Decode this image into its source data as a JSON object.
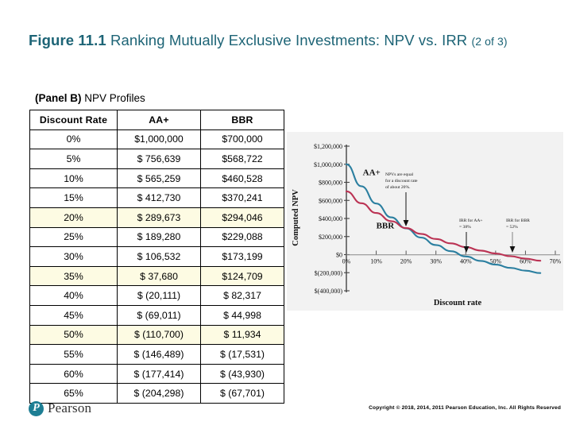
{
  "title": {
    "figure_number": "Figure 11.1",
    "figure_text": " Ranking Mutually Exclusive Investments: NPV vs. IRR ",
    "subtitle": "(2 of 3)",
    "color": "#1d6476"
  },
  "panel": {
    "label": "(Panel B)",
    "text": " NPV Profiles"
  },
  "table": {
    "headers": [
      "Discount Rate",
      "AA+",
      "BBR"
    ],
    "highlight_color": "#fdfbe3",
    "rows": [
      {
        "rate": "0%",
        "aa": "$1,000,000",
        "bbr": "$700,000",
        "highlight": false
      },
      {
        "rate": "5%",
        "aa": "$ 756,639",
        "bbr": "$568,722",
        "highlight": false
      },
      {
        "rate": "10%",
        "aa": "$ 565,259",
        "bbr": "$460,528",
        "highlight": false
      },
      {
        "rate": "15%",
        "aa": "$ 412,730",
        "bbr": "$370,241",
        "highlight": false
      },
      {
        "rate": "20%",
        "aa": "$ 289,673",
        "bbr": "$294,046",
        "highlight": true
      },
      {
        "rate": "25%",
        "aa": "$ 189,280",
        "bbr": "$229,088",
        "highlight": false
      },
      {
        "rate": "30%",
        "aa": "$ 106,532",
        "bbr": "$173,199",
        "highlight": false
      },
      {
        "rate": "35%",
        "aa": "$  37,680",
        "bbr": "$124,709",
        "highlight": true
      },
      {
        "rate": "40%",
        "aa": "$ (20,111)",
        "bbr": "$ 82,317",
        "highlight": false
      },
      {
        "rate": "45%",
        "aa": "$ (69,011)",
        "bbr": "$ 44,998",
        "highlight": false
      },
      {
        "rate": "50%",
        "aa": "$ (110,700)",
        "bbr": "$ 11,934",
        "highlight": true
      },
      {
        "rate": "55%",
        "aa": "$ (146,489)",
        "bbr": "$ (17,531)",
        "highlight": false
      },
      {
        "rate": "60%",
        "aa": "$ (177,414)",
        "bbr": "$ (43,930)",
        "highlight": false
      },
      {
        "rate": "65%",
        "aa": "$ (204,298)",
        "bbr": "$ (67,701)",
        "highlight": false
      }
    ]
  },
  "chart_data": {
    "type": "line",
    "title": "",
    "xlabel": "Discount rate",
    "ylabel": "Computed NPV",
    "xlim": [
      0,
      70
    ],
    "ylim": [
      -400000,
      1200000
    ],
    "grid": false,
    "legend_position": "inline-labels",
    "xtick_labels": [
      "0%",
      "10%",
      "20%",
      "30%",
      "40%",
      "50%",
      "60%",
      "70%"
    ],
    "xtick_values": [
      0,
      10,
      20,
      30,
      40,
      50,
      60,
      70
    ],
    "ytick_labels": [
      "$1,200,000",
      "$1,000,000",
      "$800,000",
      "$600,000",
      "$400,000",
      "$200,000",
      "$0",
      "$(200,000)",
      "$(400,000)"
    ],
    "ytick_values": [
      1200000,
      1000000,
      800000,
      600000,
      400000,
      200000,
      0,
      -200000,
      -400000
    ],
    "series": [
      {
        "name": "AA+",
        "color": "#2b7fa0",
        "x": [
          0,
          5,
          10,
          15,
          20,
          25,
          30,
          35,
          40,
          45,
          50,
          55,
          60,
          65
        ],
        "values": [
          1000000,
          756639,
          565259,
          412730,
          289673,
          189280,
          106532,
          37680,
          -20111,
          -69011,
          -110700,
          -146489,
          -177414,
          -204298
        ]
      },
      {
        "name": "BBR",
        "color": "#bb3354",
        "x": [
          0,
          5,
          10,
          15,
          20,
          25,
          30,
          35,
          40,
          45,
          50,
          55,
          60,
          65
        ],
        "values": [
          700000,
          568722,
          460528,
          370241,
          294046,
          229088,
          173199,
          124709,
          82317,
          44998,
          11934,
          -17531,
          -43930,
          -67701
        ]
      }
    ],
    "annotations": [
      {
        "id": "crossover",
        "text": "NPVs are equal for a discount rate of about 20%.",
        "x": 20
      },
      {
        "id": "irr-aa",
        "text": "IRR for AA+ = 38%",
        "x": 38
      },
      {
        "id": "irr-bbr",
        "text": "IRR for BBR = 52%",
        "x": 52
      }
    ]
  },
  "footer": {
    "brand": "Pearson",
    "brand_mark": "P",
    "copyright": "Copyright © 2018, 2014, 2011 Pearson Education, Inc. All Rights Reserved"
  }
}
